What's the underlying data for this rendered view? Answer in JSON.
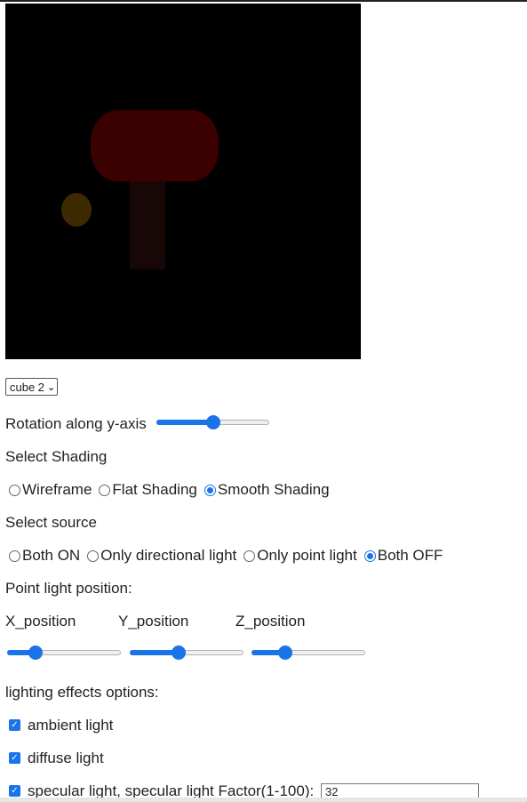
{
  "object_select": {
    "value": "cube 2"
  },
  "rotation": {
    "label": "Rotation along y-axis",
    "value_percent": 50
  },
  "shading": {
    "heading": "Select Shading",
    "options": [
      "Wireframe",
      "Flat Shading",
      "Smooth Shading"
    ],
    "selected": "Smooth Shading"
  },
  "source": {
    "heading": "Select source",
    "options": [
      "Both ON",
      "Only directional light",
      "Only point light",
      "Both OFF"
    ],
    "selected": "Both OFF"
  },
  "point_light": {
    "heading": "Point light position:",
    "x_label": "X_position",
    "y_label": "Y_position",
    "z_label": "Z_position",
    "x_value_percent": 25,
    "y_value_percent": 43,
    "z_value_percent": 30
  },
  "lighting": {
    "heading": "lighting effects options:",
    "ambient_label": "ambient light",
    "diffuse_label": "diffuse light",
    "specular_label": "specular light, specular light Factor(1-100):",
    "specular_factor": "32"
  },
  "scene": {
    "background_color": "#000000",
    "lamp_head_color": "#3b0000",
    "lamp_stem_color": "#180707",
    "light_source_color": "#3d2a00"
  }
}
